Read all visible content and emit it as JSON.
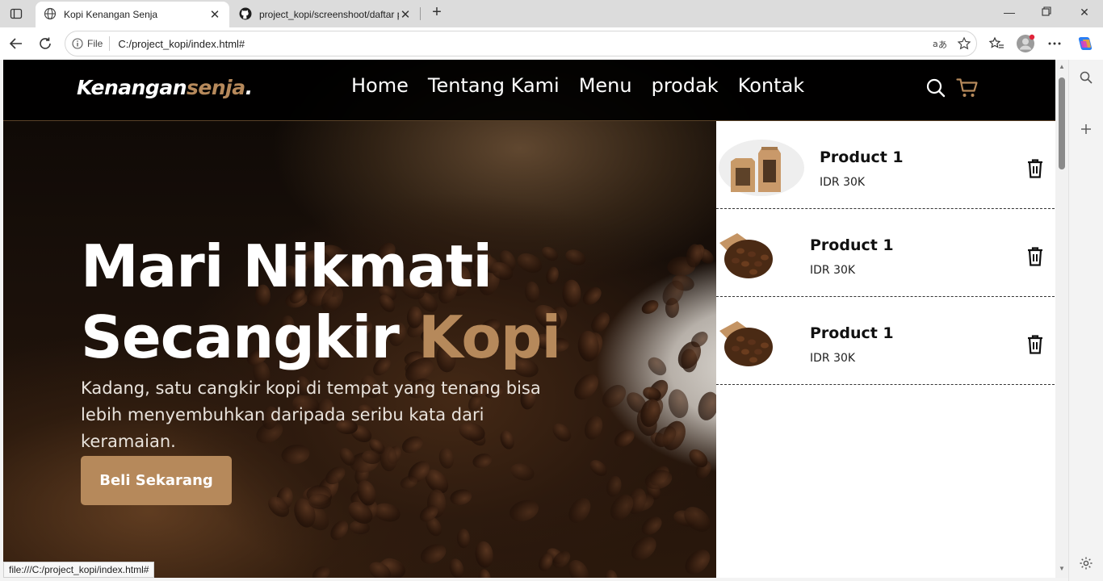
{
  "browser": {
    "tabs": [
      {
        "title": "Kopi Kenangan Senja",
        "active": true
      },
      {
        "title": "project_kopi/screenshoot/daftar p",
        "active": false
      }
    ],
    "address_badge": "File",
    "url": "C:/project_kopi/index.html#",
    "status_url": "file:///C:/project_kopi/index.html#"
  },
  "site": {
    "logo_main": "Kenangan",
    "logo_accent": "senja",
    "logo_dot": ".",
    "nav": [
      "Home",
      "Tentang Kami",
      "Menu",
      "prodak",
      "Kontak"
    ],
    "hero": {
      "title_line1": "Mari Nikmati",
      "title_line2": "Secangkir",
      "title_accent": "Kopi",
      "text": "Kadang, satu cangkir kopi di tempat yang tenang bisa lebih menyembuhkan daripada seribu kata dari keramaian.",
      "cta": "Beli Sekarang"
    },
    "cart": [
      {
        "name": "Product 1",
        "price": "IDR 30K",
        "image": "coffee-bag"
      },
      {
        "name": "Product 1",
        "price": "IDR 30K",
        "image": "coffee-beans-bag"
      },
      {
        "name": "Product 1",
        "price": "IDR 30K",
        "image": "coffee-beans-bag"
      }
    ]
  },
  "colors": {
    "accent": "#b6895b",
    "navbar": "#000000",
    "cart_bg": "#ffffff"
  }
}
